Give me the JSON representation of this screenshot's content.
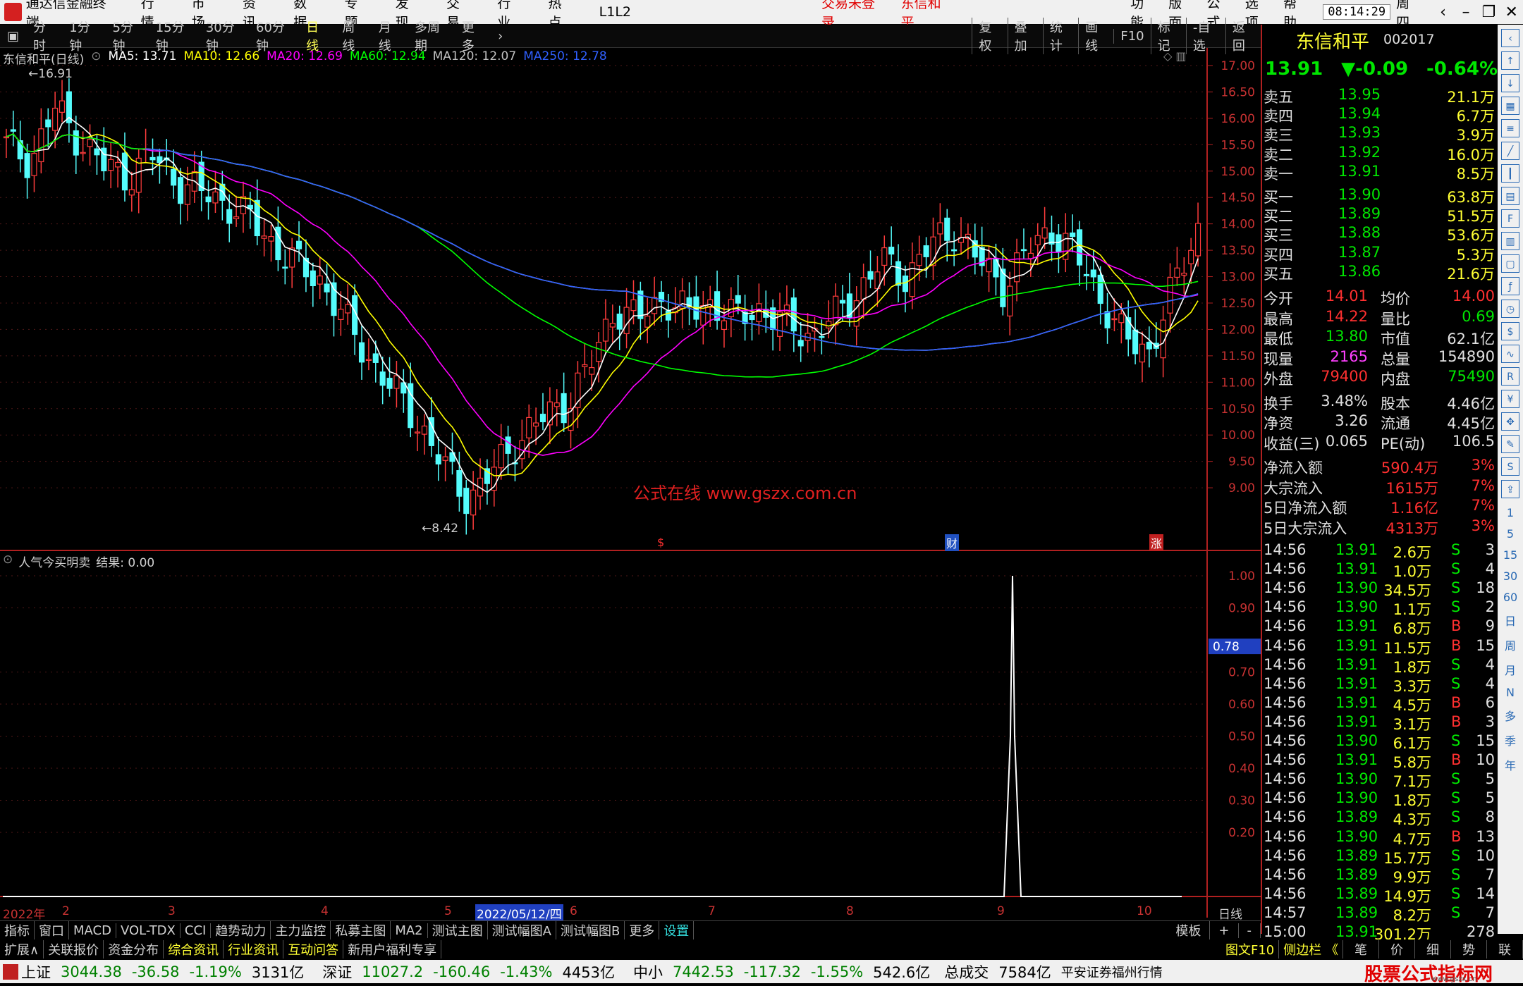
{
  "menubar": {
    "app": "通达信金融终端",
    "items": [
      "行情",
      "市场",
      "资讯",
      "数据",
      "专题",
      "发现",
      "交易",
      "行业",
      "热点",
      "L1L2"
    ],
    "login": "交易未登录",
    "stock": "东信和平",
    "right_items": [
      "功能",
      "版面",
      "公式",
      "选项",
      "帮助"
    ],
    "time": "08:14:29",
    "weekday": "周四"
  },
  "periodbar": {
    "items": [
      "分时",
      "1分钟",
      "5分钟",
      "15分钟",
      "30分钟",
      "60分钟",
      "日线",
      "周线",
      "月线",
      "多周期",
      "更多"
    ],
    "active": "日线",
    "right": [
      "复权",
      "叠加",
      "统计",
      "画线",
      "F10",
      "标记",
      "-自选",
      "返回"
    ]
  },
  "main_legend": {
    "title": "东信和平(日线)",
    "ma": [
      {
        "label": "MA5: 13.71",
        "color": "#ffffff"
      },
      {
        "label": "MA10: 12.66",
        "color": "#ffff00"
      },
      {
        "label": "MA20: 12.69",
        "color": "#ff00ff"
      },
      {
        "label": "MA60: 12.94",
        "color": "#00ff00"
      },
      {
        "label": "MA120: 12.07",
        "color": "#c0c0c0"
      },
      {
        "label": "MA250: 12.78",
        "color": "#3060ff"
      }
    ],
    "high_mark": "16.91",
    "low_mark": "8.42",
    "watermark": "公式在线  www.gszx.com.cn",
    "flags": [
      "$",
      "财",
      "涨"
    ]
  },
  "price_axis": [
    "17.00",
    "16.50",
    "16.00",
    "15.50",
    "15.00",
    "14.50",
    "14.00",
    "13.50",
    "13.00",
    "12.50",
    "12.00",
    "11.50",
    "11.00",
    "10.50",
    "10.00",
    "9.50",
    "9.00"
  ],
  "sub_legend": {
    "title": "人气今买明卖",
    "result": "结果: 0.00"
  },
  "sub_axis": [
    "1.00",
    "0.90",
    "0.78",
    "0.70",
    "0.60",
    "0.50",
    "0.40",
    "0.30",
    "0.20"
  ],
  "date_axis": {
    "labels": [
      "2022年",
      "2",
      "3",
      "4",
      "5",
      "2022/05/12/四",
      "6",
      "7",
      "8",
      "9",
      "10"
    ],
    "period": "日线"
  },
  "quote": {
    "name": "东信和平",
    "code": "002017",
    "price": "13.91",
    "change": "▼-0.09",
    "pct": "-0.64%",
    "sell": [
      {
        "l": "卖五",
        "p": "13.95",
        "v": "21.1万"
      },
      {
        "l": "卖四",
        "p": "13.94",
        "v": "6.7万"
      },
      {
        "l": "卖三",
        "p": "13.93",
        "v": "3.9万"
      },
      {
        "l": "卖二",
        "p": "13.92",
        "v": "16.0万"
      },
      {
        "l": "卖一",
        "p": "13.91",
        "v": "8.5万"
      }
    ],
    "buy": [
      {
        "l": "买一",
        "p": "13.90",
        "v": "63.8万"
      },
      {
        "l": "买二",
        "p": "13.89",
        "v": "51.5万"
      },
      {
        "l": "买三",
        "p": "13.88",
        "v": "53.6万"
      },
      {
        "l": "买四",
        "p": "13.87",
        "v": "5.3万"
      },
      {
        "l": "买五",
        "p": "13.86",
        "v": "21.6万"
      }
    ],
    "stats": [
      [
        "今开",
        "14.01",
        "均价",
        "14.00"
      ],
      [
        "最高",
        "14.22",
        "量比",
        "0.69"
      ],
      [
        "最低",
        "13.80",
        "市值",
        "62.1亿"
      ],
      [
        "现量",
        "2165",
        "总量",
        "154890"
      ],
      [
        "外盘",
        "79400",
        "内盘",
        "75490"
      ]
    ],
    "stats2": [
      [
        "换手",
        "3.48%",
        "股本",
        "4.46亿"
      ],
      [
        "净资",
        "3.26",
        "流通",
        "4.45亿"
      ],
      [
        "收益(三)",
        "0.065",
        "PE(动)",
        "106.5"
      ]
    ],
    "flow": [
      [
        "净流入额",
        "590.4万",
        "3%"
      ],
      [
        "大宗流入",
        "1615万",
        "7%"
      ],
      [
        "5日净流入额",
        "1.16亿",
        "7%"
      ],
      [
        "5日大宗流入",
        "4313万",
        "3%"
      ]
    ],
    "ticks": [
      [
        "14:56",
        "13.91",
        "2.6万",
        "S",
        "3"
      ],
      [
        "14:56",
        "13.91",
        "1.0万",
        "S",
        "4"
      ],
      [
        "14:56",
        "13.90",
        "34.5万",
        "S",
        "18"
      ],
      [
        "14:56",
        "13.90",
        "1.1万",
        "S",
        "2"
      ],
      [
        "14:56",
        "13.91",
        "6.8万",
        "B",
        "9"
      ],
      [
        "14:56",
        "13.91",
        "11.5万",
        "B",
        "15"
      ],
      [
        "14:56",
        "13.91",
        "1.8万",
        "S",
        "4"
      ],
      [
        "14:56",
        "13.91",
        "3.3万",
        "S",
        "4"
      ],
      [
        "14:56",
        "13.91",
        "4.5万",
        "B",
        "6"
      ],
      [
        "14:56",
        "13.91",
        "3.1万",
        "B",
        "3"
      ],
      [
        "14:56",
        "13.90",
        "6.1万",
        "S",
        "15"
      ],
      [
        "14:56",
        "13.91",
        "5.8万",
        "B",
        "10"
      ],
      [
        "14:56",
        "13.90",
        "7.1万",
        "S",
        "5"
      ],
      [
        "14:56",
        "13.90",
        "1.8万",
        "S",
        "5"
      ],
      [
        "14:56",
        "13.89",
        "4.3万",
        "S",
        "8"
      ],
      [
        "14:56",
        "13.90",
        "4.7万",
        "B",
        "13"
      ],
      [
        "14:56",
        "13.89",
        "15.7万",
        "S",
        "10"
      ],
      [
        "14:56",
        "13.89",
        "9.9万",
        "S",
        "7"
      ],
      [
        "14:56",
        "13.89",
        "14.9万",
        "S",
        "14"
      ],
      [
        "14:57",
        "13.89",
        "8.2万",
        "S",
        "7"
      ],
      [
        "15:00",
        "13.91",
        "301.2万",
        "",
        "278"
      ]
    ]
  },
  "right_toolbar": [
    "日",
    "周",
    "月",
    "N",
    "多",
    "季",
    "年"
  ],
  "right_toolbar_nums": [
    "1",
    "5",
    "15",
    "30",
    "60"
  ],
  "tabs1": [
    "指标",
    "窗口",
    "MACD",
    "VOL-TDX",
    "CCI",
    "趋势动力",
    "主力监控",
    "私募主图",
    "MA2",
    "测试主图",
    "测试幅图A",
    "测试幅图B",
    "更多",
    "设置"
  ],
  "tabs1_right": [
    "模板",
    "+",
    "-"
  ],
  "tabs2": [
    "扩展∧",
    "关联报价",
    "资金分布",
    "综合资讯",
    "行业资讯",
    "互动问答",
    "新用户福利专享"
  ],
  "tabs2_right": [
    "图文F10",
    "侧边栏 《",
    "笔",
    "价",
    "细",
    "势",
    "联"
  ],
  "status": {
    "sh": [
      "上证",
      "3044.38",
      "-36.58",
      "-1.19%",
      "3131亿"
    ],
    "sz": [
      "深证",
      "11027.2",
      "-160.46",
      "-1.43%",
      "4453亿"
    ],
    "zx": [
      "中小",
      "7442.53",
      "-117.32",
      "-1.55%",
      "542.6亿"
    ],
    "total": [
      "总成交",
      "7584亿"
    ],
    "broker": "平安证券福州行情",
    "logo": "股票公式指标网",
    "logo_url": "www.gszx.cn"
  },
  "chart_data": {
    "type": "candlestick",
    "title": "东信和平(日线)",
    "ylim": [
      8.2,
      17.2
    ],
    "high": 16.91,
    "low": 8.42,
    "close_series_approx": [
      15.5,
      15.2,
      16.2,
      15.6,
      15.1,
      14.9,
      15.3,
      14.8,
      14.6,
      14.4,
      14.1,
      13.6,
      13.2,
      12.9,
      12.1,
      11.4,
      10.8,
      10.2,
      9.4,
      8.8,
      9.3,
      9.9,
      10.3,
      10.6,
      11.3,
      12.4,
      12.2,
      12.6,
      12.3,
      12.5,
      12.2,
      12.4,
      12.1,
      11.9,
      12.2,
      12.7,
      13.3,
      13.0,
      13.6,
      13.9,
      13.3,
      12.8,
      13.5,
      13.9,
      13.4,
      12.6,
      11.8,
      11.6,
      12.8,
      13.91
    ],
    "indicator": {
      "name": "人气今买明卖",
      "result": 0.0,
      "spike_value": 1.0,
      "axis_marker": 0.78
    }
  }
}
